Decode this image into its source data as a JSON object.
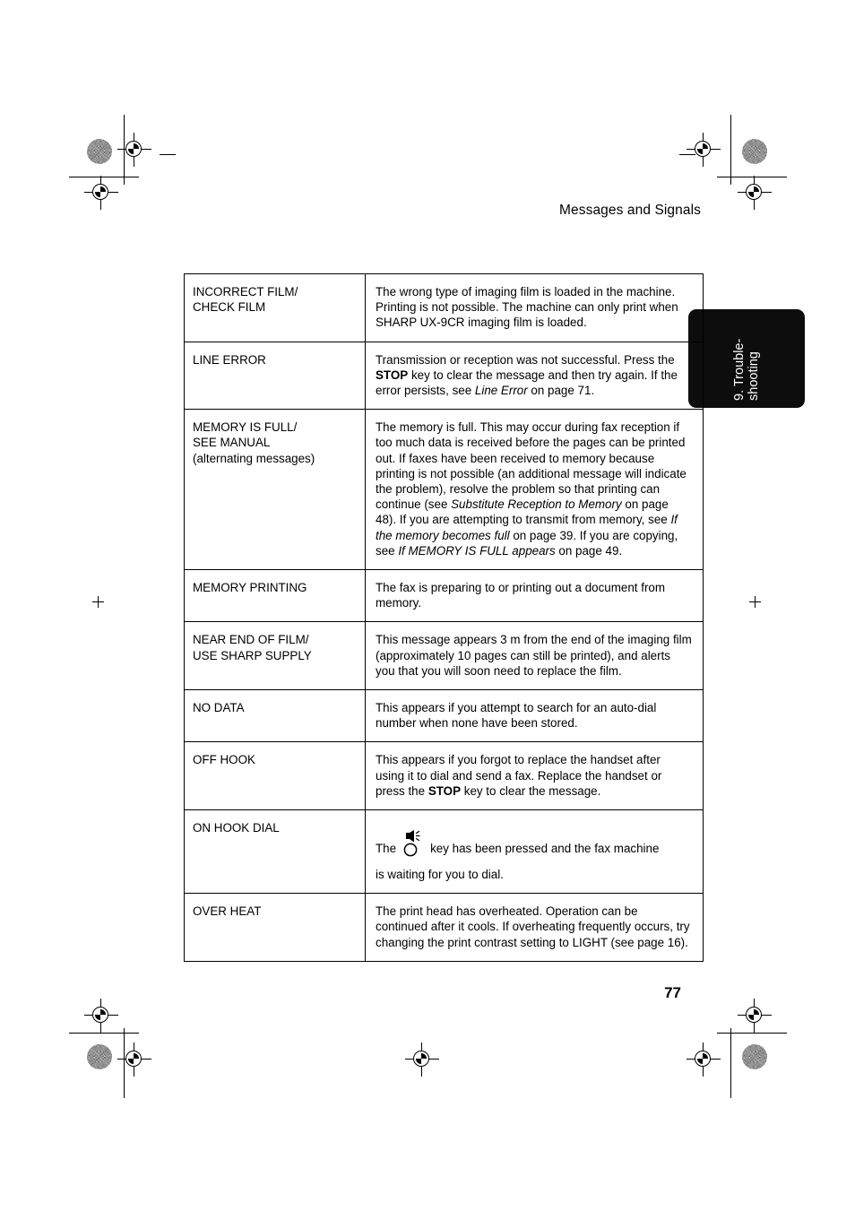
{
  "header": {
    "running_title": "Messages and Signals"
  },
  "thumb_tab": {
    "line1": "9. Trouble-",
    "line2": "shooting"
  },
  "footer": {
    "page_number": "77"
  },
  "icons": {
    "speaker_key": "speaker-key-icon"
  },
  "table": {
    "rows": [
      {
        "message_lines": [
          "INCORRECT FILM/",
          "CHECK FILM"
        ],
        "description": "The wrong type of imaging film is loaded in the machine. Printing is not possible. The machine can only print when SHARP UX-9CR imaging film  is loaded."
      },
      {
        "message_lines": [
          "LINE ERROR"
        ],
        "description_parts": [
          {
            "text": "Transmission or reception was not successful. Press the ",
            "style": "normal"
          },
          {
            "text": "STOP",
            "style": "bold"
          },
          {
            "text": " key to clear the message and then try again. If the error persists, see ",
            "style": "normal"
          },
          {
            "text": "Line Error",
            "style": "italic"
          },
          {
            "text": " on page 71.",
            "style": "normal"
          }
        ]
      },
      {
        "message_lines": [
          "MEMORY IS FULL/",
          "SEE MANUAL",
          "(alternating messages)"
        ],
        "description_parts": [
          {
            "text": "The memory is full. This may occur during fax reception if too much data is received before the pages can be printed out. If faxes have been received to memory because printing is not possible (an additional message will indicate the problem), resolve the problem so that printing can continue (see ",
            "style": "normal"
          },
          {
            "text": "Substitute Reception to Memory",
            "style": "italic"
          },
          {
            "text": " on page 48). If you are attempting to transmit from memory, see ",
            "style": "normal"
          },
          {
            "text": "If the memory becomes full",
            "style": "italic"
          },
          {
            "text": " on page 39. If you are copying, see ",
            "style": "normal"
          },
          {
            "text": "If MEMORY IS FULL appears",
            "style": "italic"
          },
          {
            "text": " on page 49.",
            "style": "normal"
          }
        ]
      },
      {
        "message_lines": [
          "MEMORY PRINTING"
        ],
        "description": "The fax is preparing to or printing out a document from memory."
      },
      {
        "message_lines": [
          "NEAR END OF FILM/",
          "USE SHARP SUPPLY"
        ],
        "description": "This message appears 3 m from the end of the imaging film  (approximately 10 pages can still be printed), and alerts you that you will soon need to replace the film."
      },
      {
        "message_lines": [
          "NO DATA"
        ],
        "description": "This appears if you attempt to search for an auto-dial number when none have been stored."
      },
      {
        "message_lines": [
          "OFF HOOK"
        ],
        "description_parts": [
          {
            "text": "This appears if you forgot to replace the handset after using it to dial and send a fax. Replace the handset or press the ",
            "style": "normal"
          },
          {
            "text": "STOP",
            "style": "bold"
          },
          {
            "text": " key to clear the message.",
            "style": "normal"
          }
        ]
      },
      {
        "message_lines": [
          "ON HOOK DIAL"
        ],
        "description_before_icon": "The",
        "description_after_icon": "key has been pressed and the fax machine",
        "description_line2": "is waiting for you to dial."
      },
      {
        "message_lines": [
          "OVER HEAT"
        ],
        "description": "The print head has overheated. Operation can be continued after it cools. If overheating frequently occurs, try changing the print contrast setting to LIGHT (see page 16)."
      }
    ]
  }
}
